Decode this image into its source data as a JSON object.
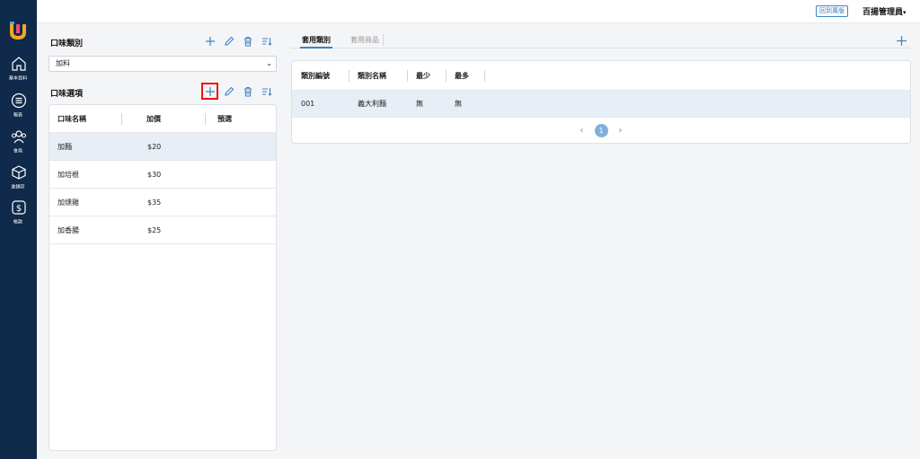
{
  "sidebar": {
    "items": [
      {
        "label": "基本資料",
        "icon": "home-icon"
      },
      {
        "label": "報表",
        "icon": "report-icon"
      },
      {
        "label": "會員",
        "icon": "members-icon"
      },
      {
        "label": "進銷存",
        "icon": "inventory-box-icon"
      },
      {
        "label": "帳款",
        "icon": "dollar-icon"
      }
    ]
  },
  "topbar": {
    "back_label": "回到萬版",
    "user_name": "百揚管理員",
    "caret": "▾"
  },
  "flavor_category": {
    "title": "口味類別",
    "selected": "加料",
    "arrow": "⌄"
  },
  "flavor_options": {
    "title": "口味選項",
    "headers": [
      "口味名稱",
      "加價",
      "預選"
    ],
    "rows": [
      {
        "name": "加麵",
        "price": "$20",
        "preset": ""
      },
      {
        "name": "加培根",
        "price": "$30",
        "preset": ""
      },
      {
        "name": "加燻雞",
        "price": "$35",
        "preset": ""
      },
      {
        "name": "加香腸",
        "price": "$25",
        "preset": ""
      }
    ]
  },
  "tabs": {
    "active": "套用類別",
    "inactive": "套用商品"
  },
  "categories": {
    "headers": [
      "類別編號",
      "類別名稱",
      "最少",
      "最多"
    ],
    "rows": [
      {
        "id": "001",
        "name": "義大利麵",
        "min": "無",
        "max": "無"
      }
    ]
  },
  "pagination": {
    "prev": "‹",
    "current": "1",
    "next": "›"
  },
  "colors": {
    "sidebar": "#0f2a4a",
    "accent": "#3b82c4",
    "highlight": "#e11111"
  }
}
